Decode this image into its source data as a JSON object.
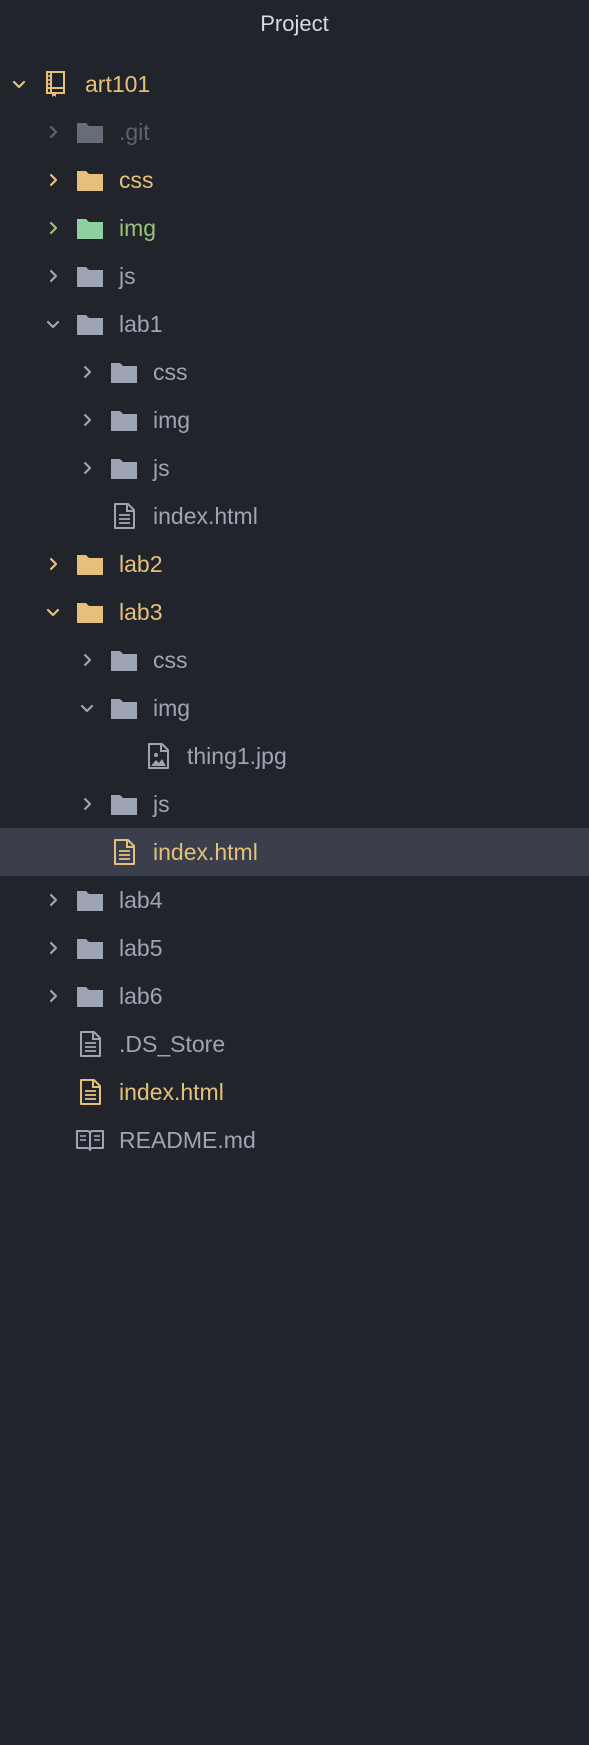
{
  "panel": {
    "title": "Project"
  },
  "colors": {
    "background": "#21252b",
    "selected_row": "#3a3f4b",
    "default_text": "#9da5b4",
    "modified": "#e5c07b",
    "added": "#98c379",
    "ignored": "#5c6370",
    "folder_default": "#9da5b4",
    "folder_modified": "#e5c07b",
    "folder_added": "#8fd19e",
    "folder_ignored": "#676d78"
  },
  "tree": [
    {
      "label": "art101",
      "depth": 0,
      "type": "repo",
      "expanded": true,
      "status": "root",
      "icon": "repo-icon"
    },
    {
      "label": ".git",
      "depth": 1,
      "type": "folder",
      "expanded": false,
      "status": "ignored",
      "icon": "folder-icon"
    },
    {
      "label": "css",
      "depth": 1,
      "type": "folder",
      "expanded": false,
      "status": "modified",
      "icon": "folder-icon"
    },
    {
      "label": "img",
      "depth": 1,
      "type": "folder",
      "expanded": false,
      "status": "added",
      "icon": "folder-icon"
    },
    {
      "label": "js",
      "depth": 1,
      "type": "folder",
      "expanded": false,
      "status": "default",
      "icon": "folder-icon"
    },
    {
      "label": "lab1",
      "depth": 1,
      "type": "folder",
      "expanded": true,
      "status": "default",
      "icon": "folder-icon"
    },
    {
      "label": "css",
      "depth": 2,
      "type": "folder",
      "expanded": false,
      "status": "default",
      "icon": "folder-icon"
    },
    {
      "label": "img",
      "depth": 2,
      "type": "folder",
      "expanded": false,
      "status": "default",
      "icon": "folder-icon"
    },
    {
      "label": "js",
      "depth": 2,
      "type": "folder",
      "expanded": false,
      "status": "default",
      "icon": "folder-icon"
    },
    {
      "label": "index.html",
      "depth": 2,
      "type": "file",
      "status": "default",
      "icon": "file-text-icon"
    },
    {
      "label": "lab2",
      "depth": 1,
      "type": "folder",
      "expanded": false,
      "status": "modified",
      "icon": "folder-icon"
    },
    {
      "label": "lab3",
      "depth": 1,
      "type": "folder",
      "expanded": true,
      "status": "modified",
      "icon": "folder-icon"
    },
    {
      "label": "css",
      "depth": 2,
      "type": "folder",
      "expanded": false,
      "status": "default",
      "icon": "folder-icon"
    },
    {
      "label": "img",
      "depth": 2,
      "type": "folder",
      "expanded": true,
      "status": "default",
      "icon": "folder-icon"
    },
    {
      "label": "thing1.jpg",
      "depth": 3,
      "type": "file",
      "status": "default",
      "icon": "file-image-icon"
    },
    {
      "label": "js",
      "depth": 2,
      "type": "folder",
      "expanded": false,
      "status": "default",
      "icon": "folder-icon"
    },
    {
      "label": "index.html",
      "depth": 2,
      "type": "file",
      "status": "modified",
      "icon": "file-text-icon",
      "selected": true
    },
    {
      "label": "lab4",
      "depth": 1,
      "type": "folder",
      "expanded": false,
      "status": "default",
      "icon": "folder-icon"
    },
    {
      "label": "lab5",
      "depth": 1,
      "type": "folder",
      "expanded": false,
      "status": "default",
      "icon": "folder-icon"
    },
    {
      "label": "lab6",
      "depth": 1,
      "type": "folder",
      "expanded": false,
      "status": "default",
      "icon": "folder-icon"
    },
    {
      "label": ".DS_Store",
      "depth": 1,
      "type": "file",
      "status": "default",
      "icon": "file-text-icon"
    },
    {
      "label": "index.html",
      "depth": 1,
      "type": "file",
      "status": "modified",
      "icon": "file-text-icon"
    },
    {
      "label": "README.md",
      "depth": 1,
      "type": "file",
      "status": "default",
      "icon": "book-icon"
    }
  ]
}
